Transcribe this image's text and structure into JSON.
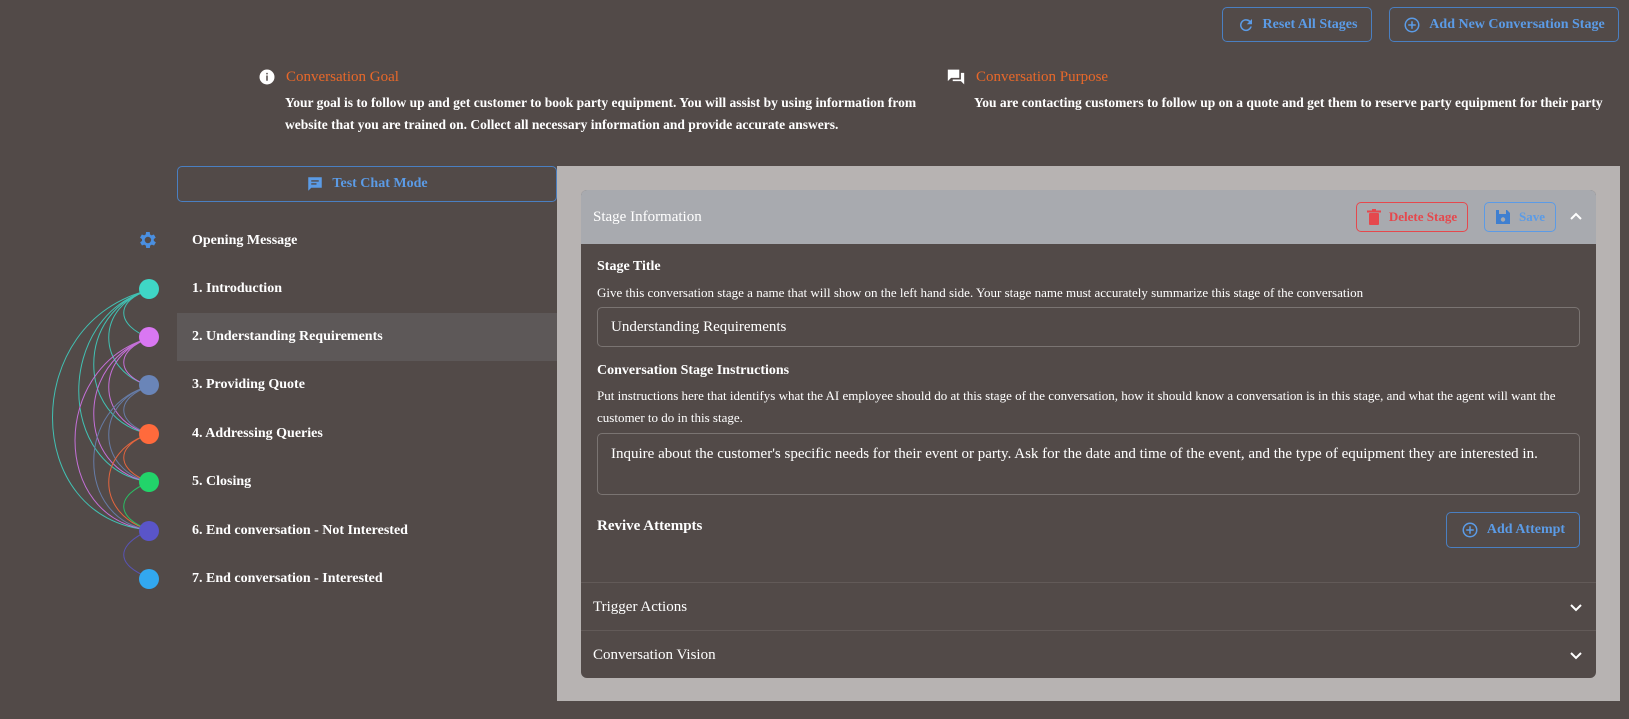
{
  "toolbar": {
    "reset_label": "Reset All Stages",
    "add_stage_label": "Add New Conversation Stage"
  },
  "goal": {
    "title": "Conversation Goal",
    "text": "Your goal is to follow up and get customer to book party equipment. You will assist by using information from website that you are trained on. Collect all necessary information and provide accurate answers."
  },
  "purpose": {
    "title": "Conversation Purpose",
    "text": "You are contacting customers to follow up on a quote and get them to reserve party equipment for their party"
  },
  "test_chat_label": "Test Chat Mode",
  "opening_message_label": "Opening Message",
  "stages": [
    {
      "label": "1. Introduction",
      "color": "#3fd6c6"
    },
    {
      "label": "2. Understanding Requirements",
      "color": "#d977f2",
      "active": true
    },
    {
      "label": "3. Providing Quote",
      "color": "#6a85b8"
    },
    {
      "label": "4. Addressing Queries",
      "color": "#ff6a3c"
    },
    {
      "label": "5. Closing",
      "color": "#22d46a"
    },
    {
      "label": "6. End conversation - Not Interested",
      "color": "#5a55c9"
    },
    {
      "label": "7. End conversation - Interested",
      "color": "#32a8f0"
    }
  ],
  "stage_info": {
    "header_title": "Stage Information",
    "delete_label": "Delete Stage",
    "save_label": "Save",
    "stage_title_label": "Stage Title",
    "stage_title_help": "Give this conversation stage a name that will show on the left hand side. Your stage name must accurately summarize this stage of the conversation",
    "stage_title_value": "Understanding Requirements",
    "instructions_label": "Conversation Stage Instructions",
    "instructions_help": "Put instructions here that identifys what the AI employee should do at this stage of the conversation, how it should know a conversation is in this stage, and what the agent will want the customer to do in this stage.",
    "instructions_value": "Inquire about the customer's specific needs for their event or party. Ask for the date and time of the event, and the type of equipment they are interested in.",
    "revive_label": "Revive Attempts",
    "add_attempt_label": "Add Attempt"
  },
  "sections": {
    "trigger_actions": "Trigger Actions",
    "conversation_vision": "Conversation Vision"
  },
  "colors": {
    "background": "#524a48",
    "accent_blue": "#5b9be6",
    "accent_orange": "#e8682a",
    "danger": "#e5484d"
  }
}
